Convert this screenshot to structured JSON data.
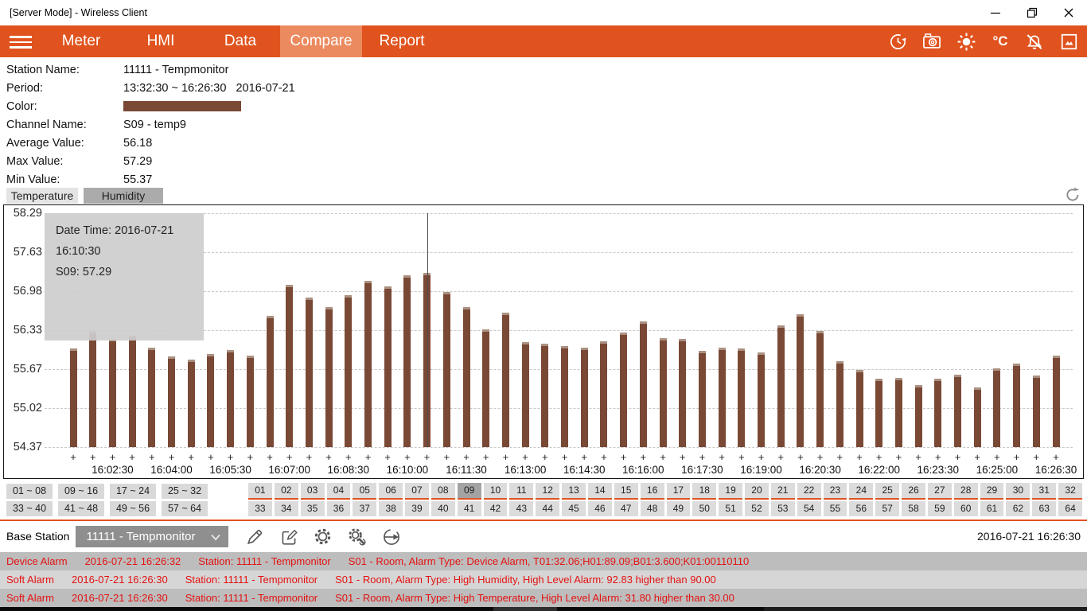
{
  "window": {
    "title": "[Server Mode] - Wireless Client"
  },
  "nav": {
    "items": [
      {
        "label": "Meter",
        "active": false
      },
      {
        "label": "HMI",
        "active": false
      },
      {
        "label": "Data",
        "active": false
      },
      {
        "label": "Compare",
        "active": true
      },
      {
        "label": "Report",
        "active": false
      }
    ],
    "right_icons": [
      "sync-clock-icon",
      "camera-icon",
      "sun-icon",
      "celsius-icon",
      "alarm-mute-icon",
      "screenshot-frame-icon"
    ],
    "celsius_label": "°C"
  },
  "info": {
    "rows": [
      {
        "label": "Station Name:",
        "value": "11111 - Tempmonitor"
      },
      {
        "label": "Period:",
        "value": "13:32:30 ~ 16:26:30   2016-07-21"
      },
      {
        "label": "Color:",
        "value": "",
        "swatch": true
      },
      {
        "label": "Channel Name:",
        "value": "S09 - temp9"
      },
      {
        "label": "Average Value:",
        "value": "56.18"
      },
      {
        "label": "Max Value:",
        "value": "57.29"
      },
      {
        "label": "Min Value:",
        "value": "55.37"
      }
    ],
    "swatch_color": "#7a4935"
  },
  "tabs": [
    {
      "label": "Temperature",
      "selected": false
    },
    {
      "label": "Humidity",
      "selected": true
    }
  ],
  "chart_data": {
    "type": "bar",
    "series": [
      {
        "name": "S09 - temp9",
        "color": "#7a4935"
      }
    ],
    "x": [
      "16:01:30",
      "16:02:00",
      "16:02:30",
      "16:03:00",
      "16:03:30",
      "16:04:00",
      "16:04:30",
      "16:05:00",
      "16:05:30",
      "16:06:00",
      "16:06:30",
      "16:07:00",
      "16:07:30",
      "16:08:00",
      "16:08:30",
      "16:09:00",
      "16:09:30",
      "16:10:00",
      "16:10:30",
      "16:11:00",
      "16:11:30",
      "16:12:00",
      "16:12:30",
      "16:13:00",
      "16:13:30",
      "16:14:00",
      "16:14:30",
      "16:15:00",
      "16:15:30",
      "16:16:00",
      "16:16:30",
      "16:17:00",
      "16:17:30",
      "16:18:00",
      "16:18:30",
      "16:19:00",
      "16:19:30",
      "16:20:00",
      "16:20:30",
      "16:21:00",
      "16:21:30",
      "16:22:00",
      "16:22:30",
      "16:23:00",
      "16:23:30",
      "16:24:00",
      "16:24:30",
      "16:25:00",
      "16:25:30",
      "16:26:00",
      "16:26:30"
    ],
    "values": [
      56.02,
      56.32,
      56.18,
      56.24,
      56.04,
      55.89,
      55.84,
      55.93,
      56.0,
      55.9,
      56.57,
      57.09,
      56.88,
      56.72,
      56.92,
      57.16,
      57.06,
      57.25,
      57.29,
      56.97,
      56.72,
      56.34,
      56.62,
      56.13,
      56.11,
      56.06,
      56.04,
      56.14,
      56.29,
      56.48,
      56.2,
      56.18,
      55.98,
      56.04,
      56.03,
      55.96,
      56.41,
      56.6,
      56.32,
      55.81,
      55.66,
      55.52,
      55.53,
      55.41,
      55.52,
      55.58,
      55.37,
      55.69,
      55.77,
      55.57,
      55.9
    ],
    "y_tick_labels": [
      "58.29",
      "57.63",
      "56.98",
      "56.33",
      "55.67",
      "55.02",
      "54.37"
    ],
    "ylim": [
      54.37,
      58.29
    ],
    "x_tick_label_indices": [
      2,
      5,
      8,
      11,
      14,
      17,
      20,
      23,
      26,
      29,
      32,
      35,
      38,
      41,
      44,
      47,
      50
    ],
    "grid": "dashed-horizontal",
    "highlight_index": 18,
    "tooltip": {
      "line1": "Date Time: 2016-07-21 16:10:30",
      "line2": "S09: 57.29"
    }
  },
  "channel_ranges": [
    "01 ~ 08",
    "09 ~ 16",
    "17 ~ 24",
    "25 ~ 32",
    "33 ~ 40",
    "41 ~ 48",
    "49 ~ 56",
    "57 ~ 64"
  ],
  "channels": {
    "top": [
      "01",
      "02",
      "03",
      "04",
      "05",
      "06",
      "07",
      "08",
      "09",
      "10",
      "11",
      "12",
      "13",
      "14",
      "15",
      "16",
      "17",
      "18",
      "19",
      "20",
      "21",
      "22",
      "23",
      "24",
      "25",
      "26",
      "27",
      "28",
      "29",
      "30",
      "31",
      "32"
    ],
    "bottom": [
      "33",
      "34",
      "35",
      "36",
      "37",
      "38",
      "39",
      "40",
      "41",
      "42",
      "43",
      "44",
      "45",
      "46",
      "47",
      "48",
      "49",
      "50",
      "51",
      "52",
      "53",
      "54",
      "55",
      "56",
      "57",
      "58",
      "59",
      "60",
      "61",
      "62",
      "63",
      "64"
    ],
    "selected": "09"
  },
  "base_station": {
    "label": "Base Station",
    "selected": "11111 - Tempmonitor",
    "tool_icons": [
      "pencil-icon",
      "edit-note-icon",
      "gear-icon",
      "gear-wrench-icon",
      "sync-arrow-icon"
    ],
    "datetime": "2016-07-21 16:26:30"
  },
  "alarms": [
    {
      "type": "Device Alarm",
      "time": "2016-07-21 16:26:32",
      "station": "Station: 11111 - Tempmonitor",
      "message": "S01 - Room, Alarm Type: Device Alarm, T01:32.06;H01:89.09;B01:3.600;K01:00110110"
    },
    {
      "type": "Soft Alarm",
      "time": "2016-07-21 16:26:30",
      "station": "Station: 11111 - Tempmonitor",
      "message": "S01 - Room, Alarm Type: High Humidity, High Level Alarm: 92.83 higher than 90.00"
    },
    {
      "type": "Soft Alarm",
      "time": "2016-07-21 16:26:30",
      "station": "Station: 11111 - Tempmonitor",
      "message": "S01 - Room, Alarm Type: High Temperature, High Level Alarm: 31.80 higher than 30.00"
    }
  ],
  "colors": {
    "accent_orange": "#e0531e",
    "active_tab_orange": "#ec8a5f",
    "bar_brown": "#7a4935",
    "alarm_red": "#e31212",
    "selected_cell_gray": "#a3a3a3"
  }
}
